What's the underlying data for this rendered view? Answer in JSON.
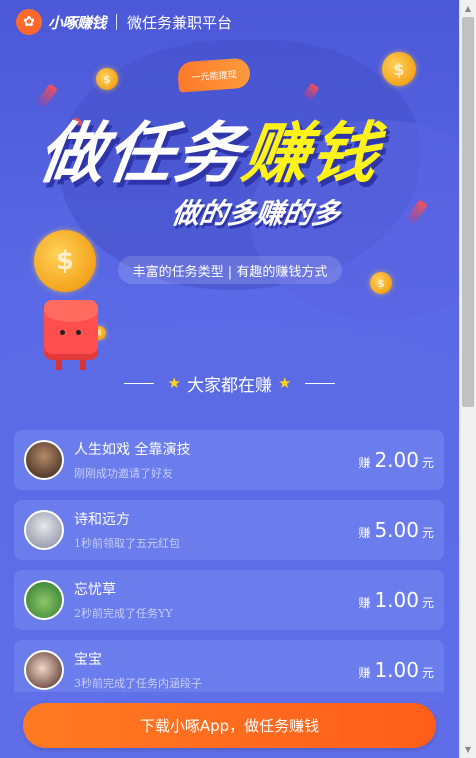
{
  "header": {
    "logo_text": "小啄赚钱",
    "slogan": "微任务兼职平台"
  },
  "hero": {
    "badge": "一元能提现",
    "title_part1": "做任务",
    "title_part2": "赚钱",
    "subtitle": "做的多赚的多",
    "tagline": "丰富的任务类型 | 有趣的赚钱方式"
  },
  "section": {
    "title": "大家都在赚"
  },
  "feed": [
    {
      "name": "人生如戏 全靠演技",
      "desc": "刚刚成功邀请了好友",
      "earn_prefix": "赚",
      "amount": "2.00",
      "unit": "元"
    },
    {
      "name": "诗和远方",
      "desc": "1秒前领取了五元红包",
      "earn_prefix": "赚",
      "amount": "5.00",
      "unit": "元"
    },
    {
      "name": "忘忧草",
      "desc": "2秒前完成了任务YY",
      "earn_prefix": "赚",
      "amount": "1.00",
      "unit": "元"
    },
    {
      "name": "宝宝",
      "desc": "3秒前完成了任务内涵段子",
      "earn_prefix": "赚",
      "amount": "1.00",
      "unit": "元"
    }
  ],
  "cta": {
    "label": "下载小啄App，做任务赚钱"
  },
  "colors": {
    "background": "#5a6ae6",
    "card": "#6b7cec",
    "accent_yellow": "#fff21a",
    "cta_orange": "#ff6a1e"
  }
}
